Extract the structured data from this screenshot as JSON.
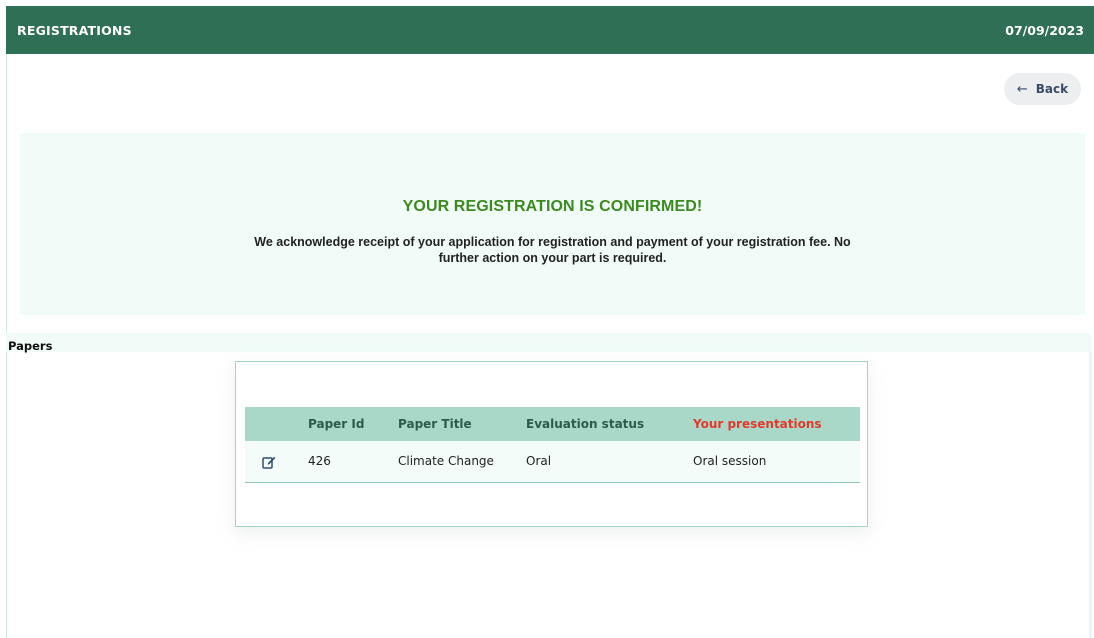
{
  "header": {
    "title": "REGISTRATIONS",
    "date": "07/09/2023"
  },
  "back_button": {
    "icon": "arrow-left-icon",
    "label": "Back"
  },
  "confirmation": {
    "title": "YOUR REGISTRATION IS CONFIRMED!",
    "message": "We acknowledge receipt of your application for registration and payment of your registration fee. No further action on your part is required."
  },
  "papers": {
    "section_label": "Papers",
    "columns": [
      "Paper Id",
      "Paper Title",
      "Evaluation status",
      "Your presentations"
    ],
    "rows": [
      {
        "action_icon": "edit-icon",
        "paper_id": "426",
        "paper_title": "Climate Change",
        "evaluation_status": "Oral",
        "presentation": "Oral session"
      }
    ]
  },
  "colors": {
    "header_bg": "#2f6f56",
    "panel_bg": "#f1fcf8",
    "confirm_title": "#3a8a1f",
    "table_header_bg": "#a9d8c9",
    "presentations_header": "#e03a2c"
  }
}
